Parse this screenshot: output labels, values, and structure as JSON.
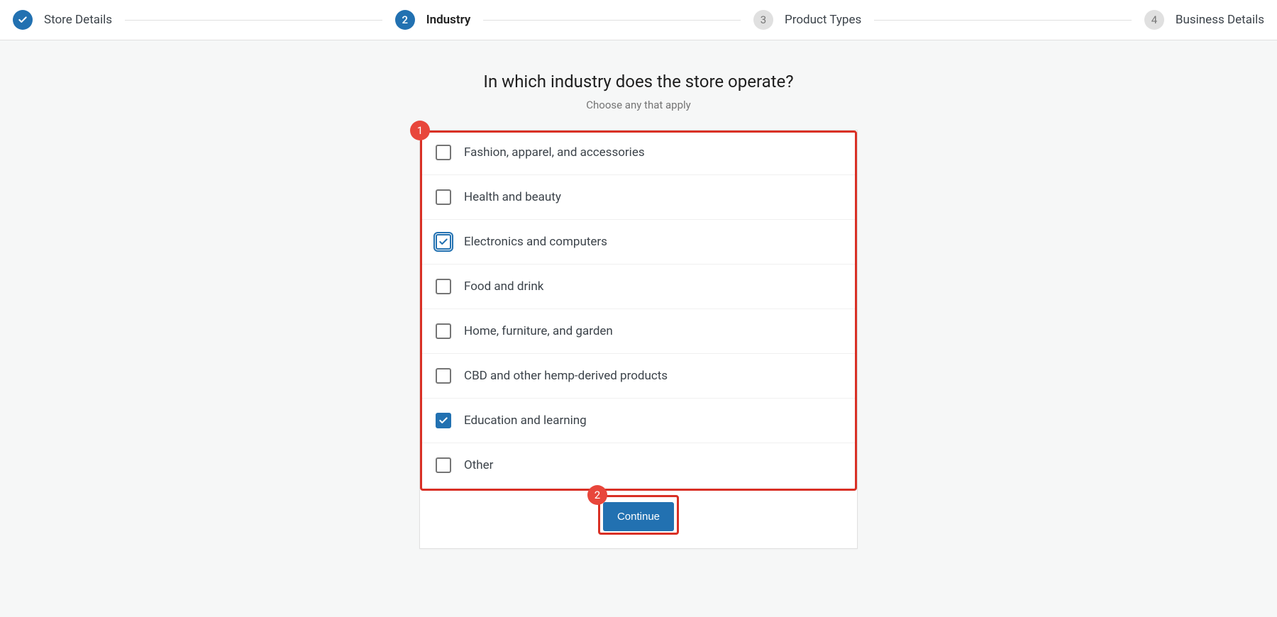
{
  "stepper": {
    "steps": [
      {
        "label": "Store Details",
        "state": "completed"
      },
      {
        "label": "Industry",
        "state": "active",
        "number": "2"
      },
      {
        "label": "Product Types",
        "state": "pending",
        "number": "3"
      },
      {
        "label": "Business Details",
        "state": "pending",
        "number": "4"
      }
    ]
  },
  "page": {
    "heading": "In which industry does the store operate?",
    "subheading": "Choose any that apply"
  },
  "options": [
    {
      "label": "Fashion, apparel, and accessories",
      "checked": false
    },
    {
      "label": "Health and beauty",
      "checked": false
    },
    {
      "label": "Electronics and computers",
      "checked": true,
      "focused": true
    },
    {
      "label": "Food and drink",
      "checked": false
    },
    {
      "label": "Home, furniture, and garden",
      "checked": false
    },
    {
      "label": "CBD and other hemp-derived products",
      "checked": false
    },
    {
      "label": "Education and learning",
      "checked": true
    },
    {
      "label": "Other",
      "checked": false
    }
  ],
  "buttons": {
    "continue": "Continue"
  },
  "annotations": {
    "badge1": "1",
    "badge2": "2"
  }
}
